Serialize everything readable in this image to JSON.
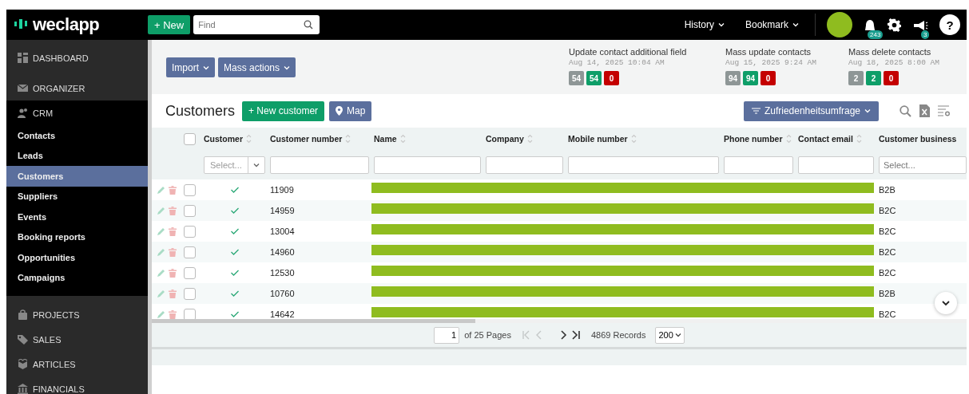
{
  "topbar": {
    "logo": "weclapp",
    "new_button": "+ New",
    "search": {
      "placeholder": "Find"
    },
    "menus": [
      {
        "label": "History"
      },
      {
        "label": "Bookmark"
      }
    ],
    "notification_count": "243",
    "announcement_count": "3",
    "help": "?"
  },
  "sidebar": {
    "sections": [
      {
        "label": "DASHBOARD",
        "expanded": false
      },
      {
        "label": "ORGANIZER",
        "expanded": false
      },
      {
        "label": "CRM",
        "expanded": true,
        "children": [
          {
            "label": "Contacts",
            "selected": false
          },
          {
            "label": "Leads",
            "selected": false
          },
          {
            "label": "Customers",
            "selected": true
          },
          {
            "label": "Suppliers",
            "selected": false
          },
          {
            "label": "Events",
            "selected": false
          },
          {
            "label": "Booking reports",
            "selected": false
          },
          {
            "label": "Opportunities",
            "selected": false
          },
          {
            "label": "Campaigns",
            "selected": false
          }
        ]
      },
      {
        "label": "PROJECTS",
        "expanded": false
      },
      {
        "label": "SALES",
        "expanded": false
      },
      {
        "label": "ARTICLES",
        "expanded": false
      },
      {
        "label": "FINANCIALS",
        "expanded": false
      }
    ]
  },
  "toolbar": {
    "buttons": [
      "Import",
      "Mass actions"
    ],
    "jobs": [
      {
        "title": "Update contact additional field",
        "date": "Aug 14, 2025 10:04 AM",
        "total": "54",
        "succeeded": "54",
        "failed": "0"
      },
      {
        "title": "Mass update contacts",
        "date": "Aug 15, 2025 9:24 AM",
        "total": "94",
        "succeeded": "94",
        "failed": "0"
      },
      {
        "title": "Mass delete contacts",
        "date": "Aug 18, 2025 8:00 AM",
        "total": "2",
        "succeeded": "2",
        "failed": "0"
      }
    ]
  },
  "list": {
    "title": "Customers",
    "new_button": "+ New customer",
    "map_button": "Map",
    "filter_button": "Zufriedenheitsumfrage"
  },
  "table": {
    "select_all_checked": false,
    "columns": [
      {
        "label": "Customer",
        "filter": {
          "kind": "select",
          "placeholder": "Select..."
        }
      },
      {
        "label": "Customer number",
        "filter": {
          "kind": "text"
        }
      },
      {
        "label": "Name",
        "filter": {
          "kind": "text"
        }
      },
      {
        "label": "Company",
        "filter": {
          "kind": "text"
        }
      },
      {
        "label": "Mobile number",
        "filter": {
          "kind": "text"
        }
      },
      {
        "label": "Phone number",
        "filter": {
          "kind": "text"
        }
      },
      {
        "label": "Contact email",
        "filter": {
          "kind": "text"
        }
      },
      {
        "label": "Customer business",
        "filter": {
          "kind": "combo",
          "placeholder": "Select..."
        }
      }
    ],
    "rows": [
      {
        "checked": false,
        "customer": true,
        "customer_number": "11909",
        "customer_business": "B2B"
      },
      {
        "checked": false,
        "customer": true,
        "customer_number": "14959",
        "customer_business": "B2C"
      },
      {
        "checked": false,
        "customer": true,
        "customer_number": "13004",
        "customer_business": "B2C"
      },
      {
        "checked": false,
        "customer": true,
        "customer_number": "14960",
        "customer_business": "B2C"
      },
      {
        "checked": false,
        "customer": true,
        "customer_number": "12530",
        "customer_business": "B2C"
      },
      {
        "checked": false,
        "customer": true,
        "customer_number": "10760",
        "customer_business": "B2B"
      },
      {
        "checked": false,
        "customer": true,
        "customer_number": "14642",
        "customer_business": "B2C"
      }
    ]
  },
  "pagination": {
    "page": "1",
    "pages_label": "of 25 Pages",
    "records": "4869 Records",
    "page_size": "200"
  }
}
